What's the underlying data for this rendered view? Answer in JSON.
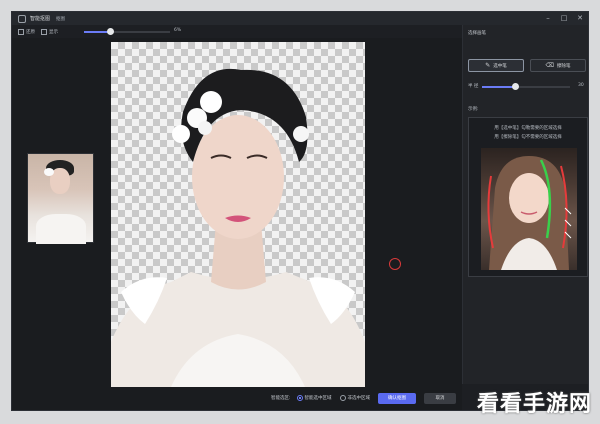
{
  "window": {
    "title": "智能抠图",
    "badge": "抠图"
  },
  "toolbar": {
    "restore_label": "还原",
    "show_label": "显示",
    "zoom_value": "0.6",
    "zoom_text": "6%"
  },
  "thumbnail": {
    "alt": "original"
  },
  "right_panel": {
    "title": "选择画笔",
    "brush_keep_label": "选中笔",
    "brush_erase_label": "擦除笔",
    "size_label": "半 径",
    "size_value": "30",
    "size_fraction": 0.38,
    "example_label": "示例:",
    "example_line1": "用【选中笔】勾勒需要的区域选择",
    "example_line2": "用【擦除笔】勾不需要的区域选择"
  },
  "bottom": {
    "label": "智能选区:",
    "option1": "智能选中区域",
    "option2": "非选中区域",
    "primary": "确认抠图",
    "secondary": "取消"
  },
  "watermark": "看看手游网",
  "colors": {
    "accent": "#5a6af0",
    "panel": "#222428",
    "background": "#1d1f23",
    "cursor": "#d83a3a"
  },
  "icons": [
    "app-logo-icon",
    "minimize-icon",
    "maximize-icon",
    "close-icon",
    "restore-icon",
    "show-icon",
    "brush-keep-icon",
    "brush-erase-icon"
  ]
}
